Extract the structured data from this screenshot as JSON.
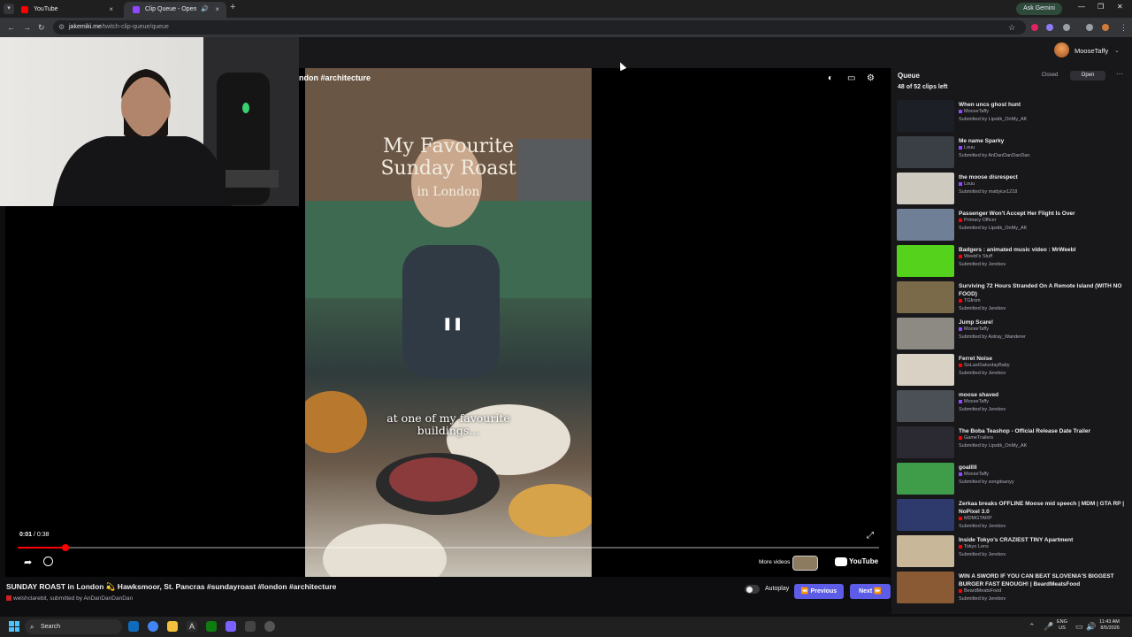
{
  "browser": {
    "tabs": [
      {
        "title": "YouTube",
        "icon": "youtube-icon",
        "close": "×"
      },
      {
        "title": "Clip Queue - Open",
        "icon": "twitch-icon",
        "close": "×"
      }
    ],
    "new_tab": "+",
    "gemini_label": "Ask Gemini",
    "url_host": "jakemiki.me",
    "url_path": "/twitch-clip-queue/queue"
  },
  "header": {
    "username": "MooseTaffy"
  },
  "player": {
    "title_overlay": "ndon #architecture",
    "overlay_heading_line1": "My Favourite",
    "overlay_heading_line2": "Sunday Roast",
    "overlay_sub": "in London",
    "caption": "at one of my favourite buildings...",
    "time_current": "0:01",
    "time_separator": " / ",
    "time_total": "0:38",
    "progress_fraction": 0.055,
    "more_videos_label": "More videos",
    "yt_logo": "YouTube"
  },
  "clip": {
    "title": "SUNDAY ROAST in London 💫 Hawksmoor, St. Pancras #sundayroast #london #architecture",
    "channel": "welshclarebit",
    "submitted": ", submitted by AnDanDanDanDan"
  },
  "controls": {
    "autoplay_label": "Autoplay",
    "autoplay_on": false,
    "previous_label": "Previous",
    "next_label": "Next"
  },
  "queue": {
    "title": "Queue",
    "count": "48 of 52 clips left",
    "tab_closed": "Closed",
    "tab_open": "Open",
    "more": "⋯",
    "items": [
      {
        "title": "When uncs ghost hunt",
        "channel": "MooseTaffy",
        "platform": "twitch",
        "submitted": "Submitted by Lipstik_OnMy_AK",
        "thumb": "#1c1f26"
      },
      {
        "title": "Me name Sparky",
        "channel": "Louu",
        "platform": "twitch",
        "submitted": "Submitted by AnDanDanDanDan",
        "thumb": "#3a3f45"
      },
      {
        "title": "the moose disrespect",
        "channel": "Louu",
        "platform": "twitch",
        "submitted": "Submitted by mattyice1218",
        "thumb": "#cfcac0"
      },
      {
        "title": "Passenger Won't Accept Her Flight Is Over",
        "channel": "Primary Officer",
        "platform": "youtube",
        "submitted": "Submitted by Lipstik_OnMy_AK",
        "thumb": "#6f7f96"
      },
      {
        "title": "Badgers : animated music video : MrWeebl",
        "channel": "Weebl's Stuff",
        "platform": "youtube",
        "submitted": "Submitted by Jerebov",
        "thumb": "#55d21c"
      },
      {
        "title": "Surviving 72 Hours Stranded On A Remote Island (WITH NO FOOD)",
        "channel": "TGfrom",
        "platform": "youtube",
        "submitted": "Submitted by Jerebov",
        "thumb": "#7a6a4a"
      },
      {
        "title": "Jump Scare!",
        "channel": "MooseTaffy",
        "platform": "twitch",
        "submitted": "Submitted by Astray_Wanderer",
        "thumb": "#8d8a84"
      },
      {
        "title": "Ferret Noise",
        "channel": "SoLastSaturdayBaby",
        "platform": "youtube",
        "submitted": "Submitted by Jerebov",
        "thumb": "#d9d2c4"
      },
      {
        "title": "moose shaved",
        "channel": "MooseTaffy",
        "platform": "twitch",
        "submitted": "Submitted by Jerebov",
        "thumb": "#4b4f56"
      },
      {
        "title": "The Boba Teashop - Official Release Date Trailer",
        "channel": "GameTrailers",
        "platform": "youtube",
        "submitted": "Submitted by Lipstik_OnMy_AK",
        "thumb": "#2b2a33"
      },
      {
        "title": "goalllll",
        "channel": "MooseTaffy",
        "platform": "twitch",
        "submitted": "Submitted by songitsanyy",
        "thumb": "#3f9d4a"
      },
      {
        "title": "Zerkaa breaks OFFLINE Moose mid speech | MDM | GTA RP | NoPixel 3.0",
        "channel": "MDMGTARP",
        "platform": "youtube",
        "submitted": "Submitted by Jerebov",
        "thumb": "#2d3a6b"
      },
      {
        "title": "Inside Tokyo's CRAZIEST TINY Apartment",
        "channel": "Tokyo Lens",
        "platform": "youtube",
        "submitted": "Submitted by Jerebov",
        "thumb": "#c9b79a"
      },
      {
        "title": "WIN A SWORD IF YOU CAN BEAT SLOVENIA'S BIGGEST BURGER FAST ENOUGH! | BeardMeatsFood",
        "channel": "BeardMeatsFood",
        "platform": "youtube",
        "submitted": "Submitted by Jerebov",
        "thumb": "#8a5a35"
      }
    ]
  },
  "taskbar": {
    "search_placeholder": "Search",
    "lang_line1": "ENG",
    "lang_line2": "US",
    "time": "11:43 AM",
    "date": "8/5/2026"
  },
  "colors": {
    "accent": "#5c5ce6",
    "twitch": "#9147ff",
    "youtube": "#ff0000"
  }
}
